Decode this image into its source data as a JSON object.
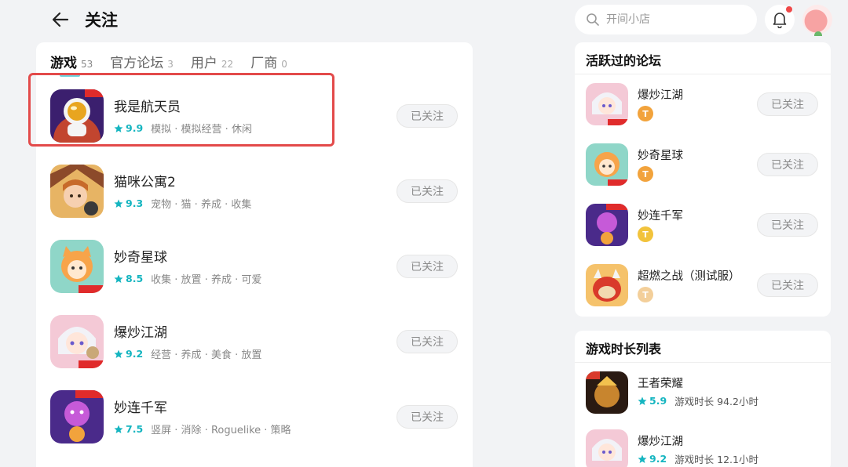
{
  "header": {
    "title": "关注",
    "search_placeholder": "开间小店"
  },
  "tabs": [
    {
      "label": "游戏",
      "count": "53",
      "active": true
    },
    {
      "label": "官方论坛",
      "count": "3",
      "active": false
    },
    {
      "label": "用户",
      "count": "22",
      "active": false
    },
    {
      "label": "厂商",
      "count": "0",
      "active": false
    }
  ],
  "games": [
    {
      "name": "我是航天员",
      "score": "9.9",
      "tags": "模拟 · 模拟经营 · 休闲",
      "follow_label": "已关注",
      "icon": "astronaut-game-icon"
    },
    {
      "name": "猫咪公寓2",
      "score": "9.3",
      "tags": "宠物 · 猫 · 养成 · 收集",
      "follow_label": "已关注",
      "icon": "cat-apartment-game-icon"
    },
    {
      "name": "妙奇星球",
      "score": "8.5",
      "tags": "收集 · 放置 · 养成 · 可爱",
      "follow_label": "已关注",
      "icon": "miaoqi-planet-game-icon"
    },
    {
      "name": "爆炒江湖",
      "score": "9.2",
      "tags": "经营 · 养成 · 美食 · 放置",
      "follow_label": "已关注",
      "icon": "baochao-jianghu-game-icon"
    },
    {
      "name": "妙连千军",
      "score": "7.5",
      "tags": "竖屏 · 消除 · Roguelike · 策略",
      "follow_label": "已关注",
      "icon": "miaolian-qianjun-game-icon"
    }
  ],
  "forums": {
    "title": "活跃过的论坛",
    "items": [
      {
        "name": "爆炒江湖",
        "follow_label": "已关注",
        "level": "T",
        "badge_color": "#f2a33c"
      },
      {
        "name": "妙奇星球",
        "follow_label": "已关注",
        "level": "T",
        "badge_color": "#f2a33c"
      },
      {
        "name": "妙连千军",
        "follow_label": "已关注",
        "level": "T",
        "badge_color": "#f2c33c"
      },
      {
        "name": "超燃之战（测试服）",
        "follow_label": "已关注",
        "level": "T",
        "badge_color": "#f3cf9a"
      }
    ]
  },
  "playtime": {
    "title": "游戏时长列表",
    "items": [
      {
        "name": "王者荣耀",
        "score": "5.9",
        "time": "游戏时长 94.2小时"
      },
      {
        "name": "爆炒江湖",
        "score": "9.2",
        "time": "游戏时长 12.1小时"
      }
    ]
  },
  "colors": {
    "accent": "#15b5c0",
    "highlight": "#e34a4a"
  }
}
